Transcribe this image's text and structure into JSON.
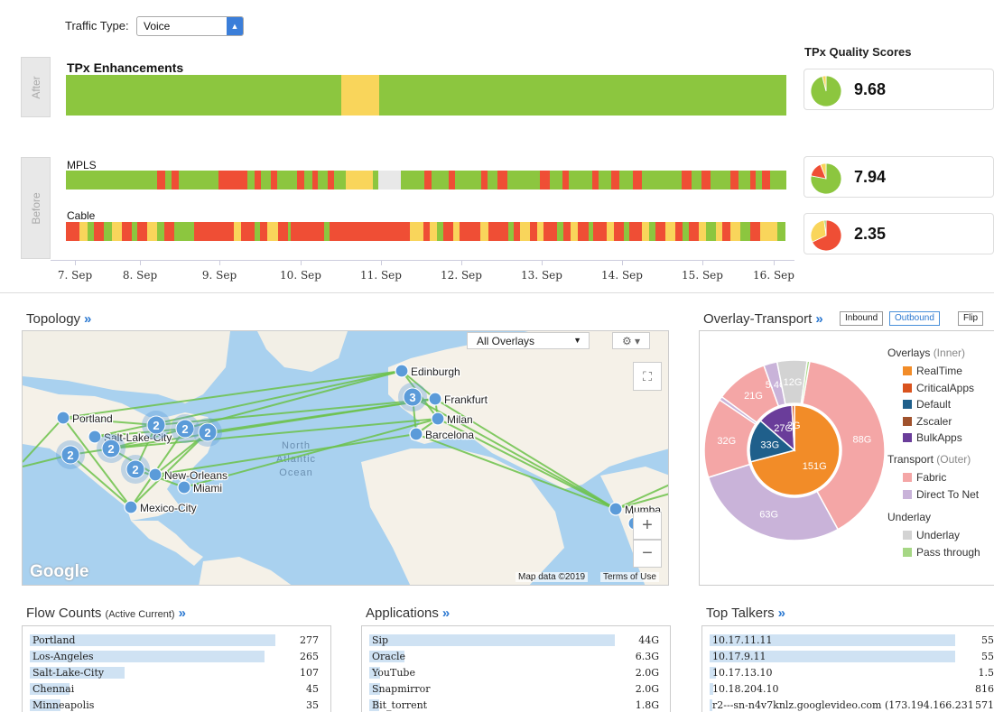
{
  "traffic_type": {
    "label": "Traffic Type:",
    "value": "Voice"
  },
  "after_label": "After",
  "before_label": "Before",
  "rows": {
    "tpx": {
      "title": "TPx Enhancements",
      "segments": [
        [
          "g",
          38.2
        ],
        [
          "y",
          5.3
        ],
        [
          "g",
          56.5
        ]
      ]
    },
    "mpls": {
      "title": "MPLS",
      "segments": [
        [
          "g",
          14
        ],
        [
          "r",
          1.2
        ],
        [
          "g",
          1
        ],
        [
          "r",
          1
        ],
        [
          "g",
          6.2
        ],
        [
          "r",
          4.4
        ],
        [
          "g",
          1
        ],
        [
          "r",
          1
        ],
        [
          "g",
          1.5
        ],
        [
          "r",
          1
        ],
        [
          "g",
          3
        ],
        [
          "r",
          1.2
        ],
        [
          "g",
          1.2
        ],
        [
          "r",
          0.8
        ],
        [
          "g",
          1.5
        ],
        [
          "r",
          1
        ],
        [
          "g",
          1.8
        ],
        [
          "y",
          4.2
        ],
        [
          "g",
          0.8
        ],
        [
          "gr",
          3.5
        ],
        [
          "g",
          3.5
        ],
        [
          "r",
          1.2
        ],
        [
          "g",
          2.5
        ],
        [
          "r",
          1
        ],
        [
          "g",
          4
        ],
        [
          "r",
          1
        ],
        [
          "g",
          1.5
        ],
        [
          "r",
          1.5
        ],
        [
          "g",
          5
        ],
        [
          "r",
          1.5
        ],
        [
          "g",
          2
        ],
        [
          "r",
          1
        ],
        [
          "g",
          3.5
        ],
        [
          "r",
          1
        ],
        [
          "g",
          2
        ],
        [
          "r",
          1.2
        ],
        [
          "g",
          2
        ],
        [
          "r",
          1.5
        ],
        [
          "g",
          6
        ],
        [
          "r",
          1.5
        ],
        [
          "g",
          1.5
        ],
        [
          "r",
          1.5
        ],
        [
          "g",
          3
        ],
        [
          "r",
          1.2
        ],
        [
          "g",
          1.8
        ],
        [
          "r",
          0.8
        ],
        [
          "g",
          1
        ],
        [
          "r",
          1.2
        ],
        [
          "g",
          2.5
        ]
      ]
    },
    "cable": {
      "title": "Cable",
      "segments": [
        [
          "r",
          2
        ],
        [
          "y",
          1.2
        ],
        [
          "g",
          1
        ],
        [
          "r",
          1.5
        ],
        [
          "g",
          1.2
        ],
        [
          "y",
          1.5
        ],
        [
          "r",
          1.5
        ],
        [
          "g",
          0.8
        ],
        [
          "r",
          1.5
        ],
        [
          "y",
          1.5
        ],
        [
          "g",
          1
        ],
        [
          "r",
          1.5
        ],
        [
          "g",
          3
        ],
        [
          "r",
          6
        ],
        [
          "y",
          1
        ],
        [
          "r",
          2
        ],
        [
          "g",
          0.8
        ],
        [
          "r",
          1.2
        ],
        [
          "y",
          1.5
        ],
        [
          "r",
          1.5
        ],
        [
          "g",
          0.5
        ],
        [
          "r",
          5
        ],
        [
          "g",
          0.8
        ],
        [
          "r",
          12
        ],
        [
          "y",
          2
        ],
        [
          "r",
          1
        ],
        [
          "y",
          1
        ],
        [
          "g",
          1
        ],
        [
          "r",
          1.5
        ],
        [
          "y",
          1
        ],
        [
          "r",
          3
        ],
        [
          "y",
          1.2
        ],
        [
          "r",
          3
        ],
        [
          "g",
          0.8
        ],
        [
          "r",
          1
        ],
        [
          "y",
          1.5
        ],
        [
          "r",
          1
        ],
        [
          "y",
          1
        ],
        [
          "r",
          2
        ],
        [
          "g",
          1
        ],
        [
          "r",
          1
        ],
        [
          "y",
          1.2
        ],
        [
          "r",
          1.5
        ],
        [
          "g",
          0.8
        ],
        [
          "r",
          2
        ],
        [
          "y",
          1
        ],
        [
          "r",
          1.5
        ],
        [
          "g",
          0.8
        ],
        [
          "r",
          2
        ],
        [
          "y",
          1
        ],
        [
          "g",
          1
        ],
        [
          "r",
          1.5
        ],
        [
          "y",
          1.5
        ],
        [
          "r",
          1
        ],
        [
          "g",
          1
        ],
        [
          "r",
          1.5
        ],
        [
          "y",
          1
        ],
        [
          "g",
          1.5
        ],
        [
          "y",
          1
        ],
        [
          "r",
          1.2
        ],
        [
          "y",
          1.5
        ],
        [
          "g",
          1.5
        ],
        [
          "r",
          1.5
        ],
        [
          "y",
          2.5
        ],
        [
          "g",
          1.3
        ]
      ]
    }
  },
  "colors": {
    "g": "#8cc63f",
    "y": "#f9d55b",
    "r": "#ef4e35",
    "gr": "#e8e8e8"
  },
  "axis_ticks": [
    "7. Sep",
    "8. Sep",
    "9. Sep",
    "10. Sep",
    "11. Sep",
    "12. Sep",
    "13. Sep",
    "14. Sep",
    "15. Sep",
    "16. Sep"
  ],
  "scores": {
    "title": "TPx Quality Scores",
    "items": [
      {
        "value": "9.68",
        "slices": [
          [
            "g",
            0.96
          ],
          [
            "y",
            0.04
          ]
        ]
      },
      {
        "value": "7.94",
        "slices": [
          [
            "g",
            0.78
          ],
          [
            "r",
            0.16
          ],
          [
            "y",
            0.06
          ]
        ]
      },
      {
        "value": "2.35",
        "slices": [
          [
            "r",
            0.68
          ],
          [
            "y",
            0.3
          ],
          [
            "g",
            0.02
          ]
        ]
      }
    ]
  },
  "topology": {
    "title": "Topology",
    "chev": "»",
    "overlay_select": "All Overlays",
    "ocean_label": "North\nAtlantic\nOcean",
    "map_data": "Map data ©2019",
    "terms": "Terms of Use",
    "google": "Google",
    "zoom_in": "+",
    "zoom_out": "−",
    "cities": [
      "Portland",
      "Salt-Lake-City",
      "New-Orleans",
      "Miami",
      "Mexico-City",
      "Edinburgh",
      "Frankfurt",
      "Milan",
      "Barcelona",
      "Mumba",
      "e"
    ],
    "clusters": [
      "2",
      "2",
      "2",
      "2",
      "2",
      "2",
      "3"
    ]
  },
  "overlay_transport": {
    "title": "Overlay-Transport",
    "chev": "»",
    "inbound": "Inbound",
    "outbound": "Outbound",
    "flip": "Flip",
    "overlays_head": "Overlays",
    "overlays_sub": "(Inner)",
    "transport_head": "Transport",
    "transport_sub": "(Outer)",
    "underlay_head": "Underlay",
    "overlays": [
      {
        "name": "RealTime",
        "color": "#f28c28"
      },
      {
        "name": "CriticalApps",
        "color": "#d9531e"
      },
      {
        "name": "Default",
        "color": "#1f5f8b"
      },
      {
        "name": "Zscaler",
        "color": "#a0522d"
      },
      {
        "name": "BulkApps",
        "color": "#6a3d9a"
      }
    ],
    "transport": [
      {
        "name": "Fabric",
        "color": "#f4a6a6"
      },
      {
        "name": "Direct To Net",
        "color": "#c9b3d9"
      }
    ],
    "underlay": [
      {
        "name": "Underlay",
        "color": "#d3d3d3"
      },
      {
        "name": "Pass through",
        "color": "#a6d785"
      }
    ],
    "inner": [
      {
        "label": "151G",
        "value": 151,
        "color": "#f28c28"
      },
      {
        "label": "33G",
        "value": 33,
        "color": "#1f5f8b"
      },
      {
        "label": "27G",
        "value": 27,
        "color": "#6a3d9a"
      },
      {
        "label": "2G",
        "value": 2,
        "color": "#d9531e"
      }
    ],
    "outer": [
      {
        "label": "88G",
        "value": 88,
        "color": "#f4a6a6"
      },
      {
        "label": "63G",
        "value": 63,
        "color": "#c9b3d9"
      },
      {
        "label": "32G",
        "value": 32,
        "color": "#f4a6a6"
      },
      {
        "label": "",
        "value": 1.5,
        "color": "#c9b3d9"
      },
      {
        "label": "21G",
        "value": 21,
        "color": "#f4a6a6"
      },
      {
        "label": "5.4G",
        "value": 5.4,
        "color": "#c9b3d9"
      },
      {
        "label": "12G",
        "value": 12,
        "color": "#d3d3d3"
      },
      {
        "label": "",
        "value": 1,
        "color": "#a6d785"
      }
    ]
  },
  "flow_counts": {
    "title": "Flow Counts",
    "sub": "(Active Current)",
    "chev": "»",
    "rows": [
      {
        "name": "Portland",
        "value": "277",
        "frac": 1.0
      },
      {
        "name": "Los-Angeles",
        "value": "265",
        "frac": 0.957
      },
      {
        "name": "Salt-Lake-City",
        "value": "107",
        "frac": 0.386
      },
      {
        "name": "Chennai",
        "value": "45",
        "frac": 0.162
      },
      {
        "name": "Minneapolis",
        "value": "35",
        "frac": 0.126
      }
    ]
  },
  "applications": {
    "title": "Applications",
    "chev": "»",
    "rows": [
      {
        "name": "Sip",
        "value": "44G",
        "frac": 1.0
      },
      {
        "name": "Oracle",
        "value": "6.3G",
        "frac": 0.143
      },
      {
        "name": "YouTube",
        "value": "2.0G",
        "frac": 0.045
      },
      {
        "name": "Snapmirror",
        "value": "2.0G",
        "frac": 0.045
      },
      {
        "name": "Bit_torrent",
        "value": "1.8G",
        "frac": 0.041
      }
    ]
  },
  "top_talkers": {
    "title": "Top Talkers",
    "chev": "»",
    "rows": [
      {
        "name": "10.17.11.11",
        "value": "55",
        "frac": 1.0
      },
      {
        "name": "10.17.9.11",
        "value": "55",
        "frac": 1.0
      },
      {
        "name": "10.17.13.10",
        "value": "1.5",
        "frac": 0.027
      },
      {
        "name": "10.18.204.10",
        "value": "816",
        "frac": 0.015
      },
      {
        "name": "r2---sn-n4v7knlz.googlevideo.com (173.194.166.231",
        "value": "571",
        "frac": 0.01
      }
    ]
  }
}
